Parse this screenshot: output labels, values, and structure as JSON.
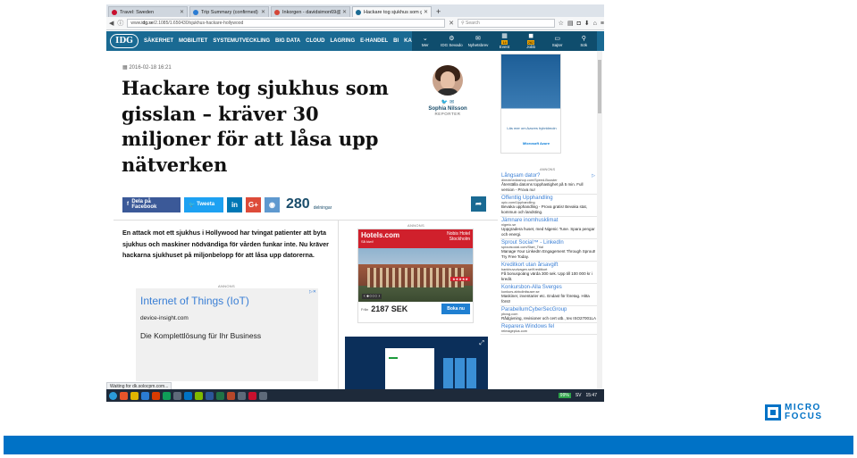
{
  "browser": {
    "tabs": [
      {
        "label": "Travel: Sweden",
        "color": "#c8102e"
      },
      {
        "label": "Trip Summary (confirmed)",
        "color": "#2b7cd3"
      },
      {
        "label": "Inkorgen - davidsimon69@...",
        "color": "#d44638"
      },
      {
        "label": "Hackare tog sjukhus som g...",
        "color": "#1a6a93"
      }
    ],
    "new_tab": "+",
    "url_prefix": "www.",
    "url_domain": "idg.se",
    "url_rest": "/2.1085/1.650430/sjukhus-hackare-hollywood",
    "search_placeholder": "Search"
  },
  "site": {
    "logo": "IDG",
    "nav": [
      "SÄKERHET",
      "MOBILITET",
      "SYSTEMUTVECKLING",
      "BIG DATA",
      "CLOUD",
      "LAGRING",
      "E-HANDEL",
      "BI",
      "KARRIÄR",
      "OUTSO"
    ],
    "right_nav": [
      {
        "label": "Mer",
        "sym": "⌄"
      },
      {
        "label": "IDG Sevado",
        "sym": "⚙"
      },
      {
        "label": "Nyhetsbrev",
        "sym": "✉"
      },
      {
        "label": "Event",
        "sym": "▦",
        "badge": "14"
      },
      {
        "label": "Jobb",
        "sym": "◼",
        "badge": "262"
      },
      {
        "label": "Sajter",
        "sym": "▭"
      },
      {
        "label": "Sök",
        "sym": "⚲"
      }
    ]
  },
  "article": {
    "date": "2016-02-18 16:21",
    "headline": "Hackare tog sjukhus som gisslan – kräver 30 miljoner för att låsa upp nätverken",
    "author_name": "Sophia Nilsson",
    "author_role": "REPORTER",
    "share_fb": "Dela på Facebook",
    "share_tw": "Tweeta",
    "share_count": "280",
    "share_count_label": "delningar",
    "lead": "En attack mot ett sjukhus i Hollywood har tvingat patienter att byta sjukhus och maskiner nödvändiga för vården funkar inte. Nu kräver hackarna sjukhuset på miljonbelopp för att låsa upp datorerna."
  },
  "ads": {
    "annons": "ANNONS",
    "iot_title": "Internet of Things (IoT)",
    "iot_url": "device-insight.com",
    "iot_desc": "Die Komplettlösung für Ihr Business",
    "hotel_brand": "Hotels.com",
    "hotel_sub": "Så kiwi!",
    "hotel_name": "Nobis Hotel",
    "hotel_city": "Stockholm",
    "hotel_from": "Från",
    "hotel_price": "2187 SEK",
    "hotel_book": "Boka nu",
    "hotel_stars": "★★★★★",
    "sidebar_caption": "Läs mer om Azures hybridmoln",
    "sidebar_logo": "Microsoft Azure",
    "sidebar_ads": [
      {
        "title": "Långsam dator?",
        "url": "directmediashop.com/Speed-Booster",
        "desc": "Återställa datorns topphastighet på 5 min. Full version - Prova nu!"
      },
      {
        "title": "Offentlig Upphandling",
        "url": "opic.com/Upphandling",
        "desc": "Bevaka upphandling - Prova gratis! Bevaka stat, kommun och landsting."
      },
      {
        "title": "Jämnare inomhusklimat",
        "url": "nigeric.se",
        "desc": "Uppgradera huset, med Nigenic Tune. Spara pengar och energi."
      },
      {
        "title": "Sprout Social™ - LinkedIn",
        "url": "sproutsocial.com/Start_Trial",
        "desc": "Manage Your LinkedIn Engagement Through Sprout! Try Free Today."
      },
      {
        "title": "Kreditkort utan årsavgift",
        "url": "bankhuvudvagen.se/Kreditkort",
        "desc": "Få bonuspoäng värda 300 sek. Upp till 100 000 kr i kredit."
      },
      {
        "title": "Konkursbon-Alla Sverges",
        "url": "konkurs.abbolintisuser.se",
        "desc": "Maskiner, inventarier etc. Endast för företag. Hitta först!"
      },
      {
        "title": "ParabellumCyberSecGroup",
        "url": "pbcsg.com",
        "desc": "Rådgivning, revisioner och cert utb., tex ISO27001LA"
      },
      {
        "title": "Reparera Windows fel",
        "url": "reimageplus.com",
        "desc": ""
      }
    ]
  },
  "statusbar": "Waiting for dk.solocpm.com...",
  "taskbar": {
    "battery": "99%",
    "lang": "SV",
    "time": "15:47"
  },
  "brand": {
    "line1": "MICRO",
    "line2": "FOCUS"
  }
}
